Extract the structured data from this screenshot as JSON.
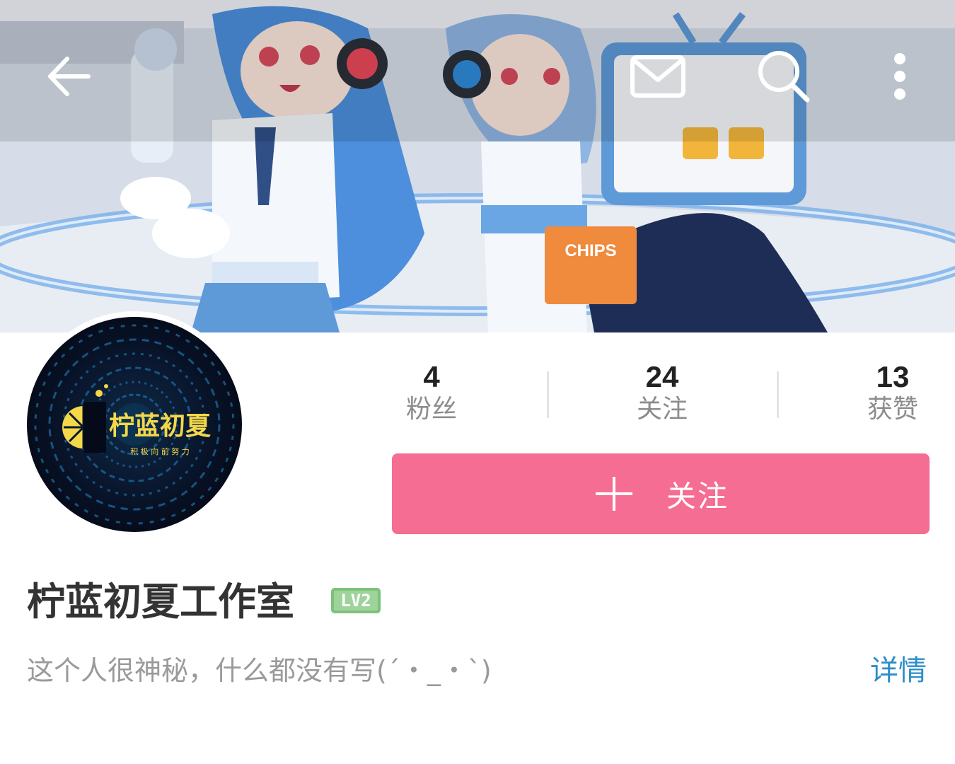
{
  "header": {
    "back_icon": "arrow-left-icon",
    "actions": [
      {
        "name": "message",
        "icon": "envelope-icon"
      },
      {
        "name": "search",
        "icon": "search-icon"
      },
      {
        "name": "more",
        "icon": "more-vertical-icon"
      }
    ],
    "banner_text": "CHIPS"
  },
  "avatar": {
    "logo_text": "柠蓝初夏",
    "tagline": "积 极 向 前 努 力"
  },
  "stats": [
    {
      "value": "4",
      "label": "粉丝"
    },
    {
      "value": "24",
      "label": "关注"
    },
    {
      "value": "13",
      "label": "获赞"
    }
  ],
  "follow_button": {
    "label": "关注",
    "icon": "plus-icon"
  },
  "profile": {
    "name": "柠蓝初夏工作室",
    "level": "LV2",
    "bio": "这个人很神秘，什么都没有写(´・_・`)",
    "detail_link": "详情"
  },
  "colors": {
    "accent_pink": "#f56d92",
    "link_blue": "#2d8ec9",
    "level_green": "#7cc27a"
  }
}
